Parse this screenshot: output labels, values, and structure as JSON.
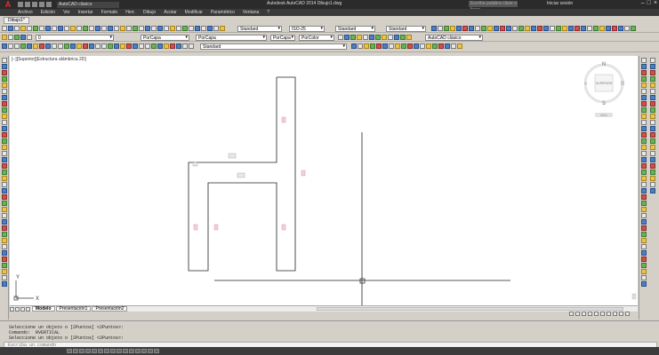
{
  "app": {
    "window_title": "Autodesk AutoCAD 2014   Dibujo1.dwg",
    "workspace": "AutoCAD clásico",
    "search_placeholder": "Escriba palabra clave o frase",
    "sign_in": "Iniciar sesión"
  },
  "menu": [
    "Archivo",
    "Edición",
    "Ver",
    "Insertar",
    "Formato",
    "Herr.",
    "Dibujo",
    "Acotar",
    "Modificar",
    "Paramétrico",
    "Ventana",
    "?"
  ],
  "file_tab": "Dibujo1*",
  "toolbars": {
    "text_style": "Standard",
    "dim_style": "ISO-25",
    "table_style": "Standard",
    "mleader_style": "Standard",
    "layer": "0",
    "color": "PorCapa",
    "linetype": "PorCapa",
    "lineweight": "PorCapa",
    "plotstyle": "PorColor",
    "workspace2": "AutoCAD clásico"
  },
  "viewport": {
    "label": "[−][Superior][Estructura alámbrica 2D]",
    "viewcube": {
      "north": "N",
      "south": "S",
      "face": "SUPERIOR",
      "wcs": "SCU"
    },
    "ucs": {
      "x": "X",
      "y": "Y"
    }
  },
  "layout_tabs": [
    "Modelo",
    "Presentación1",
    "Presentación2"
  ],
  "command_history": [
    "Seleccione un objeto o [2Puntos] <2Puntos>:",
    "Comando:  RVERTICAL",
    "Seleccione un objeto o [2Puntos] <2Puntos>:"
  ],
  "command_placeholder": "Escriba un comando",
  "status": {
    "coords": ""
  }
}
